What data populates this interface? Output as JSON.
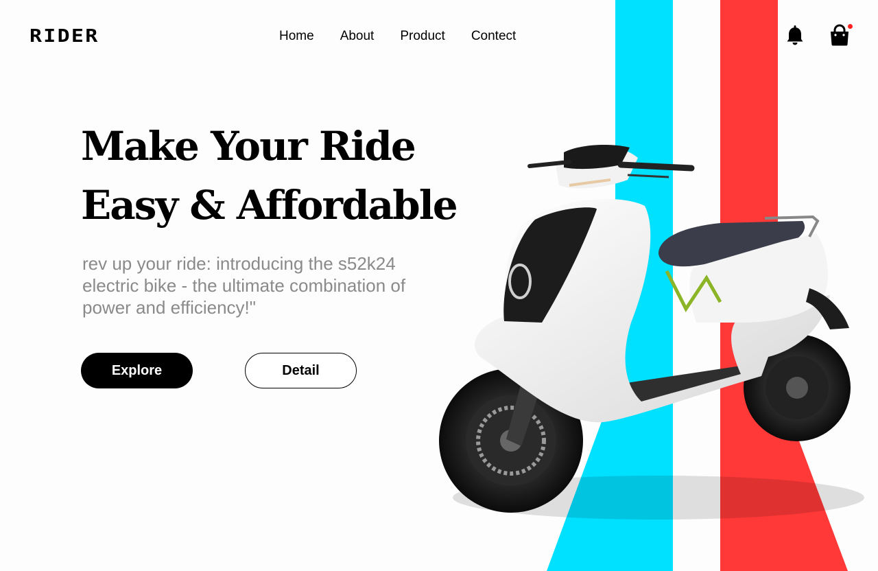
{
  "brand": {
    "logo_text": "RIDER"
  },
  "nav": {
    "items": [
      {
        "label": "Home"
      },
      {
        "label": "About"
      },
      {
        "label": "Product"
      },
      {
        "label": "Contect"
      }
    ]
  },
  "header_icons": {
    "notifications": "bell-icon",
    "cart": "shopping-bag-icon",
    "cart_badge_color": "#ff2020"
  },
  "hero": {
    "title_line1": "Make Your Ride",
    "title_line2": "Easy & Affordable",
    "subtitle": "rev up your ride: introducing the s52k24 electric bike - the ultimate combination of power and efficiency!\"",
    "primary_button": "Explore",
    "secondary_button": "Detail"
  },
  "colors": {
    "cyan_stripe": "#00e0ff",
    "red_stripe": "#ff3838",
    "primary_button_bg": "#000000",
    "subtitle_text": "#8a8a8a"
  },
  "product_image": {
    "subject": "white electric scooter"
  }
}
